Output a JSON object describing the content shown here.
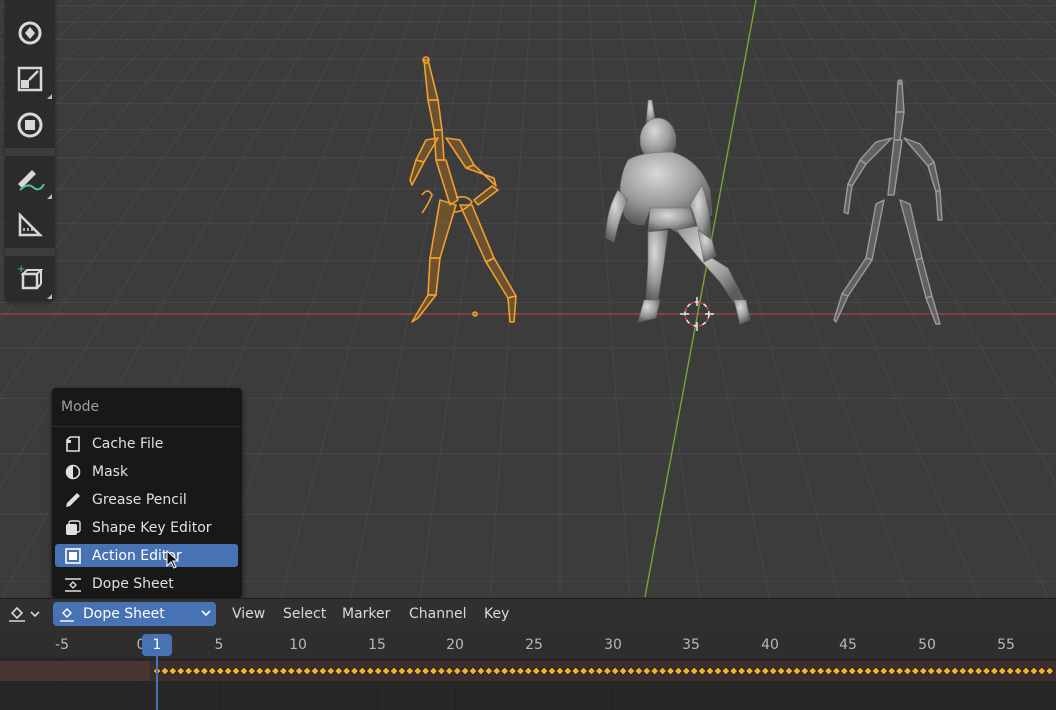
{
  "mode_menu": {
    "title": "Mode",
    "items": [
      {
        "label": "Cache File",
        "icon": "cache-file-icon"
      },
      {
        "label": "Mask",
        "icon": "mask-icon"
      },
      {
        "label": "Grease Pencil",
        "icon": "grease-pencil-icon"
      },
      {
        "label": "Shape Key Editor",
        "icon": "shape-key-icon"
      },
      {
        "label": "Action Editor",
        "icon": "action-icon",
        "active": true
      },
      {
        "label": "Dope Sheet",
        "icon": "dope-sheet-icon"
      }
    ]
  },
  "header": {
    "editor_type_icon": "dope-sheet-editor-icon",
    "mode_value": "Dope Sheet",
    "menus": [
      "View",
      "Select",
      "Marker",
      "Channel",
      "Key"
    ]
  },
  "toolbar": {
    "tools": [
      "rotate-icon",
      "scale-icon",
      "transform-icon",
      "annotate-icon",
      "measure-icon",
      "add-cube-icon"
    ]
  },
  "timeline": {
    "current_frame": "1",
    "ticks": [
      "-5",
      "0",
      "5",
      "10",
      "15",
      "20",
      "25",
      "30",
      "35",
      "40",
      "45",
      "50",
      "55"
    ]
  },
  "colors": {
    "accent": "#4772b3",
    "selected_armature": "#f0a030",
    "x_axis": "#b04848",
    "y_axis": "#7aa83a",
    "keyframe": "#f0b030"
  }
}
